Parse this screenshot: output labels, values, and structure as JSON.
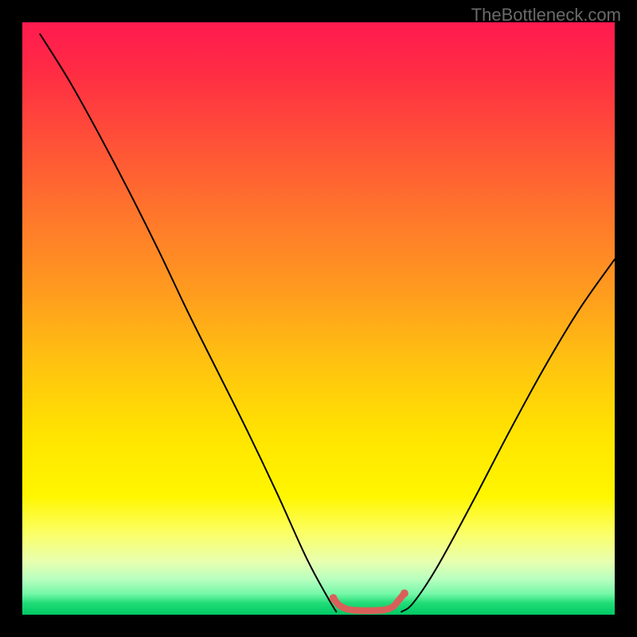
{
  "watermark": "TheBottleneck.com",
  "chart_data": {
    "type": "line",
    "title": "",
    "xlabel": "",
    "ylabel": "",
    "xlim": [
      0,
      100
    ],
    "ylim": [
      0,
      100
    ],
    "series": [
      {
        "name": "left-curve",
        "x": [
          3,
          8,
          13,
          18,
          23,
          28,
          33,
          38,
          43,
          48,
          51.5,
          53
        ],
        "y": [
          98,
          90,
          81,
          71.5,
          61.5,
          51,
          41,
          31,
          20.5,
          9.5,
          3,
          0.5
        ],
        "stroke": "#000000",
        "width": 2
      },
      {
        "name": "right-curve",
        "x": [
          64,
          66,
          70,
          76,
          82,
          88,
          94,
          100
        ],
        "y": [
          0.5,
          2,
          8,
          19,
          30.5,
          41.5,
          51.5,
          60
        ],
        "stroke": "#000000",
        "width": 2
      },
      {
        "name": "plateau-marker",
        "x": [
          52.5,
          53.5,
          55,
          57,
          59,
          61,
          62.5,
          63.5,
          64.5
        ],
        "y": [
          2.8,
          1.6,
          0.9,
          0.7,
          0.7,
          0.8,
          1.3,
          2.4,
          3.6
        ],
        "stroke": "#d9605a",
        "width": 8.5
      }
    ],
    "gradient_stops": [
      {
        "pos": 0,
        "color": "#ff1a4f"
      },
      {
        "pos": 8,
        "color": "#ff2b44"
      },
      {
        "pos": 18,
        "color": "#ff4a3a"
      },
      {
        "pos": 30,
        "color": "#ff6f2e"
      },
      {
        "pos": 45,
        "color": "#ff9a1f"
      },
      {
        "pos": 58,
        "color": "#ffc40f"
      },
      {
        "pos": 70,
        "color": "#ffe500"
      },
      {
        "pos": 80,
        "color": "#fff600"
      },
      {
        "pos": 86,
        "color": "#fcff62"
      },
      {
        "pos": 91,
        "color": "#e8ffb0"
      },
      {
        "pos": 94,
        "color": "#b8ffbf"
      },
      {
        "pos": 96.5,
        "color": "#74f7a8"
      },
      {
        "pos": 98,
        "color": "#22dd77"
      },
      {
        "pos": 100,
        "color": "#00c864"
      }
    ]
  }
}
